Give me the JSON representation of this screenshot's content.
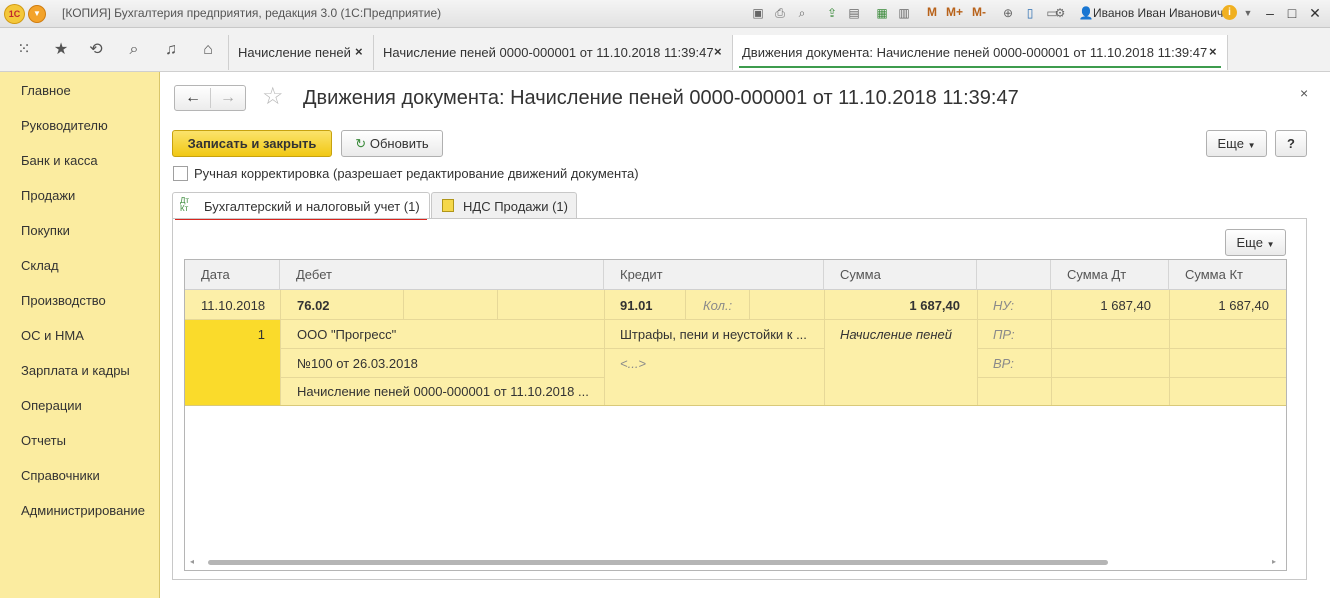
{
  "window": {
    "app_title": "[КОПИЯ] Бухгалтерия предприятия, редакция 3.0  (1С:Предприятие)",
    "logo_text": "1С",
    "memory_buttons": [
      "M",
      "M+",
      "M-"
    ],
    "user_name": "Иванов Иван Иванович"
  },
  "tabs": [
    {
      "label": "Начисление пеней"
    },
    {
      "label": "Начисление пеней 0000-000001 от 11.10.2018 11:39:47"
    },
    {
      "label": "Движения документа: Начисление пеней 0000-000001 от 11.10.2018 11:39:47",
      "active": true
    }
  ],
  "tab_close": "×",
  "sidebar": {
    "items": [
      {
        "label": "Главное"
      },
      {
        "label": "Руководителю"
      },
      {
        "label": "Банк и касса"
      },
      {
        "label": "Продажи"
      },
      {
        "label": "Покупки"
      },
      {
        "label": "Склад"
      },
      {
        "label": "Производство"
      },
      {
        "label": "ОС и НМА"
      },
      {
        "label": "Зарплата и кадры"
      },
      {
        "label": "Операции"
      },
      {
        "label": "Отчеты"
      },
      {
        "label": "Справочники"
      },
      {
        "label": "Администрирование"
      }
    ]
  },
  "form": {
    "title": "Движения документа: Начисление пеней 0000-000001 от 11.10.2018 11:39:47",
    "save_close_label": "Записать и закрыть",
    "refresh_label": "Обновить",
    "more_label": "Еще",
    "help_label": "?",
    "close_label": "×",
    "manual_edit_label": "Ручная корректировка (разрешает редактирование движений документа)",
    "manual_edit_checked": false,
    "subtabs": [
      {
        "label": "Бухгалтерский и налоговый учет (1)",
        "icon_text": "Дт\nКт",
        "active": true
      },
      {
        "label": "НДС Продажи (1)"
      }
    ]
  },
  "table": {
    "columns": [
      "Дата",
      "Дебет",
      "Кредит",
      "Сумма",
      "",
      "Сумма Дт",
      "Сумма Кт"
    ],
    "row": {
      "date": "11.10.2018",
      "number": "1",
      "debit_account": "76.02",
      "debit_sub1": "ООО \"Прогресс\"",
      "debit_sub2": "№100 от 26.03.2018",
      "debit_sub3": "Начисление пеней 0000-000001 от 11.10.2018 ...",
      "credit_account": "91.01",
      "credit_qty_label": "Кол.:",
      "credit_sub1": "Штрафы, пени и неустойки к ...",
      "credit_sub2": "<...>",
      "amount": "1 687,40",
      "content": "Начисление пеней",
      "nu_label": "НУ:",
      "pr_label": "ПР:",
      "vr_label": "ВР:",
      "sum_dt": "1 687,40",
      "sum_kt": "1 687,40"
    }
  },
  "colors": {
    "sidebar_bg": "#fbeca0",
    "row_bg": "#fcefa8",
    "row_number_bg": "#fadb2b",
    "save_button": "#f1c814",
    "active_tab_underline": "#3d9c4e",
    "active_subtab_underline": "#d9251f"
  }
}
